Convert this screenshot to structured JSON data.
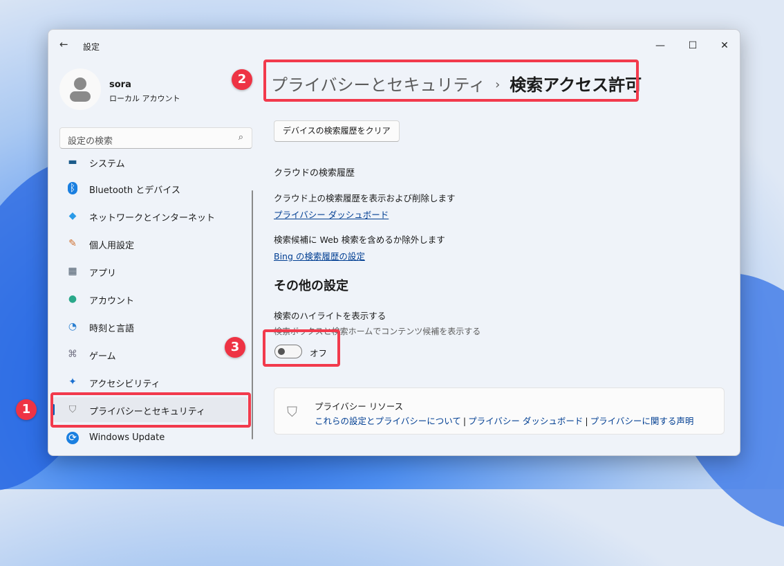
{
  "window": {
    "title": "設定",
    "back_icon": "←",
    "minimize": "—",
    "maximize": "☐",
    "close": "✕"
  },
  "user": {
    "name": "sora",
    "account_type": "ローカル アカウント"
  },
  "search": {
    "placeholder": "設定の検索",
    "icon": "⌕"
  },
  "sidebar": {
    "items": [
      {
        "label": "システム",
        "icon": "▬",
        "color": "#1a5a8a"
      },
      {
        "label": "Bluetooth とデバイス",
        "icon": "ᛒ",
        "color": "#1a7fe0"
      },
      {
        "label": "ネットワークとインターネット",
        "icon": "◆",
        "color": "#2a9ae8"
      },
      {
        "label": "個人用設定",
        "icon": "✎",
        "color": "#d07030"
      },
      {
        "label": "アプリ",
        "icon": "▦",
        "color": "#445566"
      },
      {
        "label": "アカウント",
        "icon": "●",
        "color": "#2aa88a"
      },
      {
        "label": "時刻と言語",
        "icon": "◔",
        "color": "#2a7fd0"
      },
      {
        "label": "ゲーム",
        "icon": "⌘",
        "color": "#778"
      },
      {
        "label": "アクセシビリティ",
        "icon": "✦",
        "color": "#1a6fd0"
      },
      {
        "label": "プライバシーとセキュリティ",
        "icon": "⛉",
        "color": "#777",
        "selected": true
      },
      {
        "label": "Windows Update",
        "icon": "⟳",
        "color": "#1a7fe0"
      }
    ]
  },
  "breadcrumb": {
    "parent": "プライバシーとセキュリティ",
    "separator": "›",
    "current": "検索アクセス許可"
  },
  "main": {
    "clear_button": "デバイスの検索履歴をクリア",
    "cloud_heading": "クラウドの検索履歴",
    "cloud_desc": "クラウド上の検索履歴を表示および削除します",
    "dashboard_link": "プライバシー ダッシュボード",
    "web_desc": "検索候補に Web 検索を含めるか除外します",
    "bing_link": "Bing の検索履歴の設定",
    "other_heading": "その他の設定",
    "highlight_title": "検索のハイライトを表示する",
    "highlight_desc": "検索ボックスと検索ホームでコンテンツ候補を表示する",
    "toggle_state": "オフ",
    "toggle_on": false
  },
  "resources": {
    "title": "プライバシー リソース",
    "links": [
      "これらの設定とプライバシーについて",
      "プライバシー ダッシュボード",
      "プライバシーに関する声明"
    ],
    "separator": "|"
  },
  "annotations": {
    "n1": "1",
    "n2": "2",
    "n3": "3"
  }
}
